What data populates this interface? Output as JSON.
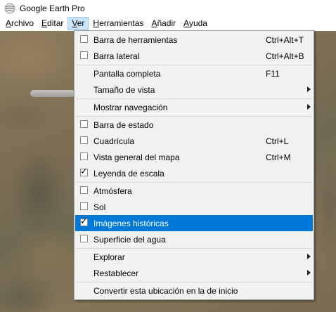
{
  "window": {
    "title": "Google Earth Pro"
  },
  "menubar": {
    "items": [
      {
        "label": "Archivo",
        "mnemonic": "A",
        "rest": "rchivo"
      },
      {
        "label": "Editar",
        "mnemonic": "E",
        "rest": "ditar"
      },
      {
        "label": "Ver",
        "mnemonic": "V",
        "rest": "er"
      },
      {
        "label": "Herramientas",
        "mnemonic": "H",
        "rest": "erramientas"
      },
      {
        "label": "Añadir",
        "mnemonic": "A",
        "rest": "ñadir"
      },
      {
        "label": "Ayuda",
        "mnemonic": "A",
        "rest": "yuda"
      }
    ],
    "active": "Ver"
  },
  "view_menu": {
    "items": [
      {
        "label": "Barra de herramientas",
        "shortcut": "Ctrl+Alt+T",
        "checkbox": true,
        "checked": false
      },
      {
        "label": "Barra lateral",
        "shortcut": "Ctrl+Alt+B",
        "checkbox": true,
        "checked": false
      },
      {
        "label": "Pantalla completa",
        "shortcut": "F11"
      },
      {
        "label": "Tamaño de vista",
        "submenu": true
      },
      {
        "label": "Mostrar navegación",
        "submenu": true
      },
      {
        "label": "Barra de estado",
        "checkbox": true,
        "checked": false
      },
      {
        "label": "Cuadrícula",
        "shortcut": "Ctrl+L",
        "checkbox": true,
        "checked": false
      },
      {
        "label": "Vista general del mapa",
        "shortcut": "Ctrl+M",
        "checkbox": true,
        "checked": false
      },
      {
        "label": "Leyenda de escala",
        "checkbox": true,
        "checked": true
      },
      {
        "label": "Atmósfera",
        "checkbox": true,
        "checked": false
      },
      {
        "label": "Sol",
        "checkbox": true,
        "checked": false
      },
      {
        "label": "Imágenes históricas",
        "checkbox": true,
        "checked": true,
        "highlighted": true
      },
      {
        "label": "Superficie del agua",
        "checkbox": true,
        "checked": false
      },
      {
        "label": "Explorar",
        "submenu": true
      },
      {
        "label": "Restablecer",
        "submenu": true
      },
      {
        "label": "Convertir esta ubicación en la de inicio"
      }
    ],
    "check_glyph": "✓"
  },
  "icons": {
    "app": "google-earth-icon",
    "check": "checkmark-icon",
    "submenu": "chevron-right-icon"
  },
  "colors": {
    "highlight": "#0078d7",
    "menu_bg": "#f2f2f2",
    "active_menu_bg": "#cce4f7"
  }
}
